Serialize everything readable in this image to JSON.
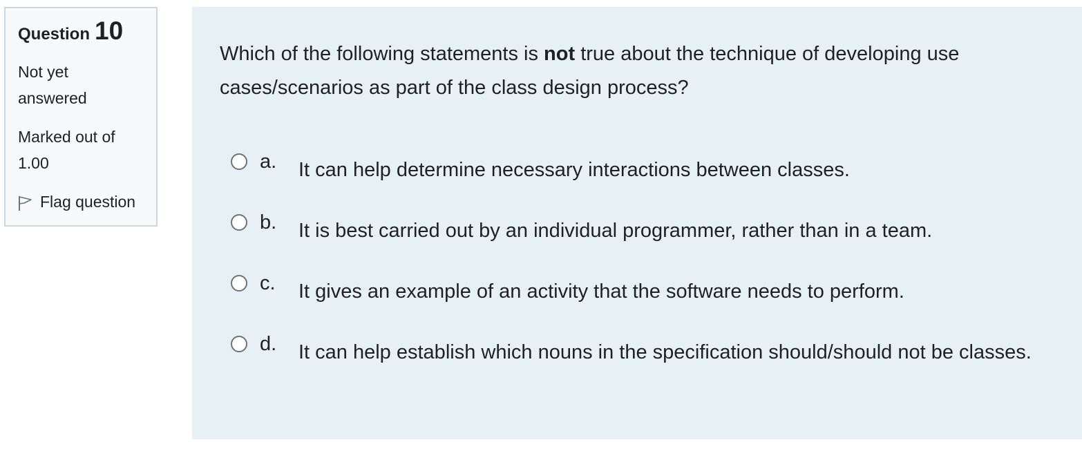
{
  "info": {
    "question_word": "Question",
    "question_number": "10",
    "state": "Not yet answered",
    "grade": "Marked out of 1.00",
    "flag_label": "Flag question",
    "flag_icon": "flag-outline-icon"
  },
  "question": {
    "text_before": "Which of the following statements is ",
    "text_bold": "not",
    "text_after": " true about the technique of developing use cases/scenarios as part of the class design process?"
  },
  "answers": [
    {
      "letter": "a.",
      "text": "It can help determine necessary interactions between classes.",
      "selected": false
    },
    {
      "letter": "b.",
      "text": "It is best carried out by an individual programmer, rather than in a team.",
      "selected": false
    },
    {
      "letter": "c.",
      "text": "It gives an example of an activity that the software needs to perform.",
      "selected": false
    },
    {
      "letter": "d.",
      "text": "It can help establish which nouns in the specification should/should not be classes.",
      "selected": false
    }
  ],
  "colors": {
    "info_bg": "#f8f9fa",
    "info_border": "#cfd6dd",
    "content_bg": "#e7f1f5",
    "text": "#1d2125"
  }
}
